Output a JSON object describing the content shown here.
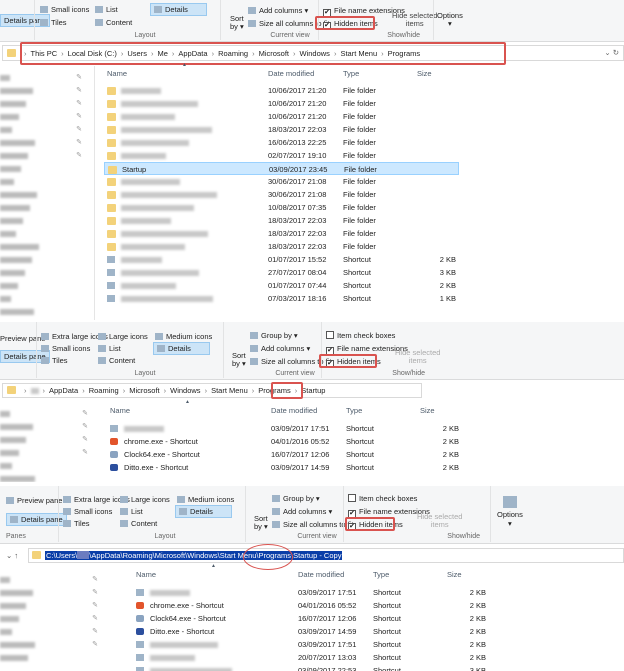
{
  "ribbon": {
    "preview_pane": "Preview pane",
    "details_pane": "Details pane",
    "panes": "Panes",
    "extra_large_icons": "Extra large icons",
    "large_icons": "Large icons",
    "medium_icons": "Medium icons",
    "small_icons": "Small icons",
    "list": "List",
    "details": "Details",
    "tiles": "Tiles",
    "content": "Content",
    "layout": "Layout",
    "sort_by": "Sort",
    "sort_by2": "by ▾",
    "group_by": "Group by ▾",
    "add_columns": "Add columns ▾",
    "size_columns": "Size all columns to fit",
    "current_view": "Current view",
    "item_check_boxes": "Item check boxes",
    "file_name_extensions": "File name extensions",
    "hidden_items": "Hidden items",
    "hide_selected": "Hide selected",
    "hide_selected2": "items",
    "show_hide": "Show/hide",
    "options": "Options",
    "options2": "▾"
  },
  "columns": {
    "name": "Name",
    "date": "Date modified",
    "type": "Type",
    "size": "Size"
  },
  "window1": {
    "breadcrumb": [
      "This PC",
      "Local Disk (C:)",
      "Users",
      "Me",
      "AppData",
      "Roaming",
      "Microsoft",
      "Windows",
      "Start Menu",
      "Programs"
    ],
    "rows": [
      {
        "name": "",
        "date": "10/06/2017 21:20",
        "type": "File folder",
        "size": ""
      },
      {
        "name": "",
        "date": "10/06/2017 21:20",
        "type": "File folder",
        "size": ""
      },
      {
        "name": "",
        "date": "10/06/2017 21:20",
        "type": "File folder",
        "size": ""
      },
      {
        "name": "",
        "date": "18/03/2017 22:03",
        "type": "File folder",
        "size": ""
      },
      {
        "name": "",
        "date": "16/06/2013 22:25",
        "type": "File folder",
        "size": ""
      },
      {
        "name": "",
        "date": "02/07/2017 19:10",
        "type": "File folder",
        "size": ""
      },
      {
        "name": "Startup",
        "date": "03/09/2017 23:45",
        "type": "File folder",
        "size": "",
        "selected": true
      },
      {
        "name": "",
        "date": "30/06/2017 21:08",
        "type": "File folder",
        "size": ""
      },
      {
        "name": "",
        "date": "30/06/2017 21:08",
        "type": "File folder",
        "size": ""
      },
      {
        "name": "",
        "date": "10/08/2017 07:35",
        "type": "File folder",
        "size": ""
      },
      {
        "name": "",
        "date": "18/03/2017 22:03",
        "type": "File folder",
        "size": ""
      },
      {
        "name": "",
        "date": "18/03/2017 22:03",
        "type": "File folder",
        "size": ""
      },
      {
        "name": "",
        "date": "18/03/2017 22:03",
        "type": "File folder",
        "size": ""
      },
      {
        "name": "",
        "date": "01/07/2017 15:52",
        "type": "Shortcut",
        "size": "2 KB"
      },
      {
        "name": "",
        "date": "27/07/2017 08:04",
        "type": "Shortcut",
        "size": "3 KB"
      },
      {
        "name": "",
        "date": "01/07/2017 07:44",
        "type": "Shortcut",
        "size": "2 KB"
      },
      {
        "name": "",
        "date": "07/03/2017 18:16",
        "type": "Shortcut",
        "size": "1 KB"
      }
    ]
  },
  "window2": {
    "breadcrumb": [
      "AppData",
      "Roaming",
      "Microsoft",
      "Windows",
      "Start Menu",
      "Programs",
      "Startup"
    ],
    "rows": [
      {
        "name": "",
        "date": "03/09/2017 17:51",
        "type": "Shortcut",
        "size": "2 KB"
      },
      {
        "name": "chrome.exe - Shortcut",
        "date": "04/01/2016 05:52",
        "type": "Shortcut",
        "size": "2 KB",
        "icon": "chrome"
      },
      {
        "name": "Clock64.exe - Shortcut",
        "date": "16/07/2017 12:06",
        "type": "Shortcut",
        "size": "2 KB",
        "icon": "clock"
      },
      {
        "name": "Ditto.exe - Shortcut",
        "date": "03/09/2017 14:59",
        "type": "Shortcut",
        "size": "2 KB",
        "icon": "ditto"
      }
    ]
  },
  "window3": {
    "path_pre": "C:\\Users\\",
    "path_post": "\\AppData\\Roaming\\Microsoft\\Windows\\Start Menu\\Programs\\Startup - Copy",
    "rows": [
      {
        "name": "",
        "date": "03/09/2017 17:51",
        "type": "Shortcut",
        "size": "2 KB"
      },
      {
        "name": "chrome.exe - Shortcut",
        "date": "04/01/2016 05:52",
        "type": "Shortcut",
        "size": "2 KB",
        "icon": "chrome"
      },
      {
        "name": "Clock64.exe - Shortcut",
        "date": "16/07/2017 12:06",
        "type": "Shortcut",
        "size": "2 KB",
        "icon": "clock"
      },
      {
        "name": "Ditto.exe - Shortcut",
        "date": "03/09/2017 14:59",
        "type": "Shortcut",
        "size": "2 KB",
        "icon": "ditto"
      },
      {
        "name": "",
        "date": "03/09/2017 17:51",
        "type": "Shortcut",
        "size": "2 KB"
      },
      {
        "name": "",
        "date": "20/07/2017 13:03",
        "type": "Shortcut",
        "size": "2 KB"
      },
      {
        "name": "",
        "date": "03/09/2017 22:53",
        "type": "Shortcut",
        "size": "3 KB"
      }
    ]
  },
  "colors": {
    "highlight": "#d9534f",
    "selection": "#cce8ff",
    "folder": "#f3d27a",
    "path_select": "#0a3ea8"
  }
}
